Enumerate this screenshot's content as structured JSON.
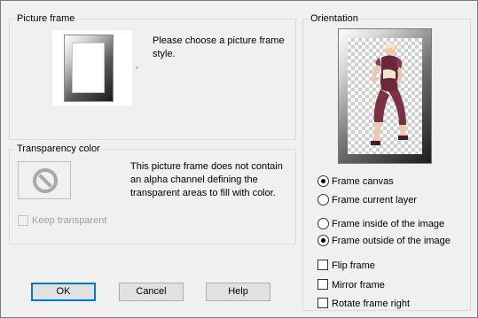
{
  "picture_frame": {
    "title": "Picture frame",
    "description": "Please choose a picture frame style."
  },
  "transparency": {
    "title": "Transparency color",
    "description": "This picture frame does not contain an alpha channel defining the transparent areas to fill with color.",
    "keep_transparent": {
      "label": "Keep transparent",
      "checked": false,
      "disabled": true
    }
  },
  "orientation": {
    "title": "Orientation",
    "frame_target": [
      {
        "label": "Frame canvas",
        "checked": true
      },
      {
        "label": "Frame current layer",
        "checked": false
      }
    ],
    "frame_position": [
      {
        "label": "Frame inside of the image",
        "checked": false
      },
      {
        "label": "Frame outside of the image",
        "checked": true
      }
    ],
    "options": [
      {
        "label": "Flip frame",
        "checked": false
      },
      {
        "label": "Mirror frame",
        "checked": false
      },
      {
        "label": "Rotate frame right",
        "checked": false
      }
    ]
  },
  "buttons": {
    "ok": "OK",
    "cancel": "Cancel",
    "help": "Help"
  },
  "colors": {
    "focus": "#0078d7",
    "dress": "#6b2838"
  },
  "icons": {
    "transparency": "no-sign-icon",
    "frame_dropdown": "dropdown-arrow-icon"
  }
}
